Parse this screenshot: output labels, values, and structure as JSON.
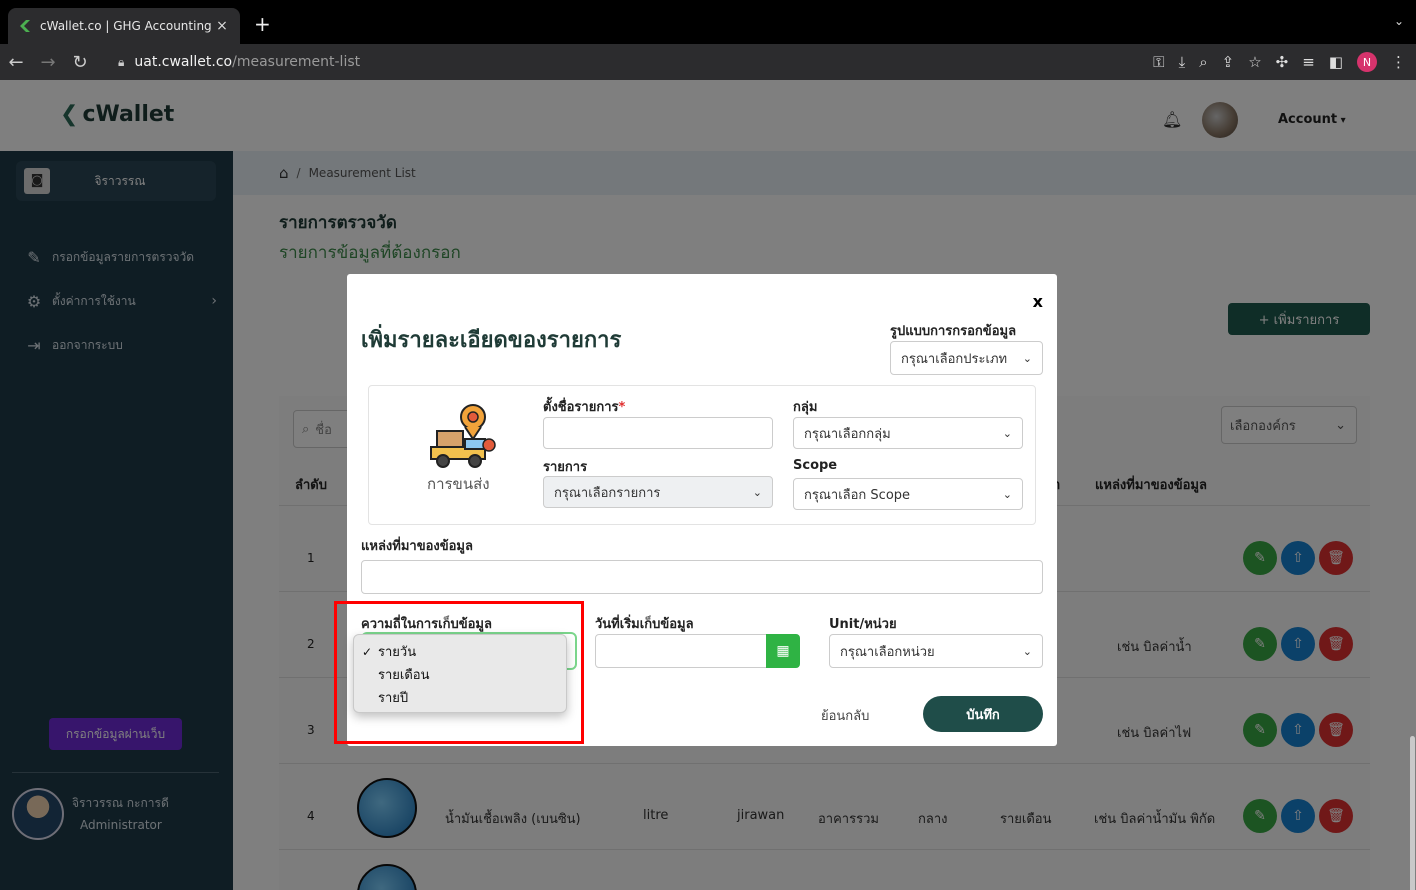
{
  "browser": {
    "tab_title": "cWallet.co | GHG Accounting S",
    "new_tab": "+",
    "tab_close": "×",
    "url_host": "uat.cwallet.co",
    "url_path": "/measurement-list",
    "profile_initial": "N"
  },
  "topnav": {
    "logo": "cWallet",
    "account": "Account"
  },
  "sidebar": {
    "profile_name": "จิราวรรณ",
    "items": [
      {
        "label": "กรอกข้อมูลรายการตรวจวัด",
        "icon": "pencil-icon"
      },
      {
        "label": "ตั้งค่าการใช้งาน",
        "icon": "gear-icon"
      },
      {
        "label": "ออกจากระบบ",
        "icon": "logout-icon"
      }
    ],
    "web_button": "กรอกข้อมูลผ่านเว็บ",
    "user_name": "จิราวรรณ กะการดี",
    "user_role": "Administrator"
  },
  "page": {
    "breadcrumb": "Measurement List",
    "breadcrumb_sep": "/",
    "title": "รายการตรวจวัด",
    "subtitle": "รายการข้อมูลที่ต้องกรอก",
    "add_button": "+ เพิ่มรายการ",
    "search_placeholder": "ชื่อ",
    "org_select": "เลือกองค์กร"
  },
  "table": {
    "headers": {
      "index": "ลำดับ",
      "partial": "า",
      "source": "แหล่งที่มาของข้อมูล"
    },
    "rows": [
      {
        "index": "1",
        "source": ""
      },
      {
        "index": "2",
        "source": "เช่น บิลค่าน้ำ"
      },
      {
        "index": "3",
        "source": "เช่น บิลค่าไฟ"
      },
      {
        "index": "4",
        "name": "น้ำมันเชื้อเพลิง (เบนซิน)",
        "unit": "litre",
        "user": "jirawan",
        "group": "อาคารรวม",
        "scope": "กลาง",
        "frequency": "รายเดือน",
        "source": "เช่น บิลค่าน้ำมัน พิกัด"
      }
    ]
  },
  "modal": {
    "close": "x",
    "title": "เพิ่มรายละเอียดของรายการ",
    "input_format_label": "รูปแบบการกรอกข้อมูล",
    "input_format_value": "กรุณาเลือกประเภท",
    "category_label": "การขนส่ง",
    "name_label": "ตั้งชื่อรายการ",
    "name_required": "*",
    "name_value": "",
    "group_label": "กลุ่ม",
    "group_value": "กรุณาเลือกกลุ่ม",
    "item_label": "รายการ",
    "item_value": "กรุณาเลือกรายการ",
    "scope_label": "Scope",
    "scope_value": "กรุณาเลือก Scope",
    "source_label": "แหล่งที่มาของข้อมูล",
    "source_value": "",
    "frequency_label": "ความถี่ในการเก็บข้อมูล",
    "frequency_options": [
      "รายวัน",
      "รายเดือน",
      "รายปี"
    ],
    "frequency_selected": "รายวัน",
    "start_date_label": "วันที่เริ่มเก็บข้อมูล",
    "unit_label": "Unit/หน่วย",
    "unit_value": "กรุณาเลือกหน่วย",
    "back": "ย้อนกลับ",
    "save": "บันทึก"
  },
  "colors": {
    "sidebar": "#1f3a48",
    "primary_dark": "#1f4d49",
    "accent_green": "#2fb344",
    "highlight": "#ff0000"
  }
}
